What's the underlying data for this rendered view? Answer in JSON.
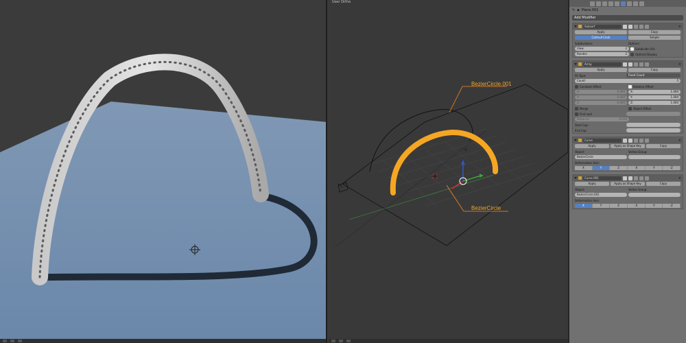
{
  "viewport_right": {
    "header_label": "User Ortho",
    "annotations": [
      "BezierCircle.001",
      "BezierCircle"
    ]
  },
  "properties": {
    "object_name": "Plane.001",
    "add_modifier": "Add Modifier",
    "modifiers": [
      {
        "name": "Subsurf",
        "apply": "Apply",
        "copy": "Copy",
        "mode_catmull": "Catmull-Clark",
        "mode_simple": "Simple",
        "subdivisions_label": "Subdivisions:",
        "options_label": "Options:",
        "view_label": "View:",
        "view_value": "2",
        "render_label": "Render:",
        "render_value": "2",
        "subdivide_uvs": "Subdivide UVs",
        "optimal_display": "Optimal Display"
      },
      {
        "name": "Array",
        "apply": "Apply",
        "copy": "Copy",
        "fit_type_label": "Fit Type:",
        "fit_type_value": "Fixed Count",
        "count_label": "Count:",
        "count_value": "5",
        "constant_offset": "Constant Offset",
        "relative_offset": "Relative Offset",
        "const_values": [
          "0.000",
          "0.000",
          "0.000"
        ],
        "rel_values": [
          "1.000",
          "1.000",
          "1.000"
        ],
        "merge": "Merge",
        "object_offset": "Object Offset",
        "first_last": "First Last",
        "distance_label": "Distance:",
        "distance_value": "0.010",
        "start_cap": "Start Cap:",
        "end_cap": "End Cap:"
      },
      {
        "name": "Curve",
        "apply": "Apply",
        "apply_shape": "Apply as Shape Key",
        "copy": "Copy",
        "object_label": "Object:",
        "object_value": "BezierCircle",
        "vertex_group_label": "Vertex Group:",
        "deformation_label": "Deformation Axis:",
        "axes": [
          "X",
          "Y",
          "Z",
          "-X",
          "-Y",
          "-Z"
        ],
        "active_axis": 1
      },
      {
        "name": "Curve.001",
        "apply": "Apply",
        "apply_shape": "Apply as Shape Key",
        "copy": "Copy",
        "object_label": "Object:",
        "object_value": "BezierCircle.001",
        "vertex_group_label": "Vertex Group:",
        "deformation_label": "Deformation Axis:",
        "axes": [
          "X",
          "Y",
          "Z",
          "-X",
          "-Y",
          "-Z"
        ],
        "active_axis": 0
      }
    ]
  },
  "colors": {
    "accent_blue": "#5680c2",
    "curve_orange": "#f5a623",
    "floor_blue": "#6f8cad"
  }
}
